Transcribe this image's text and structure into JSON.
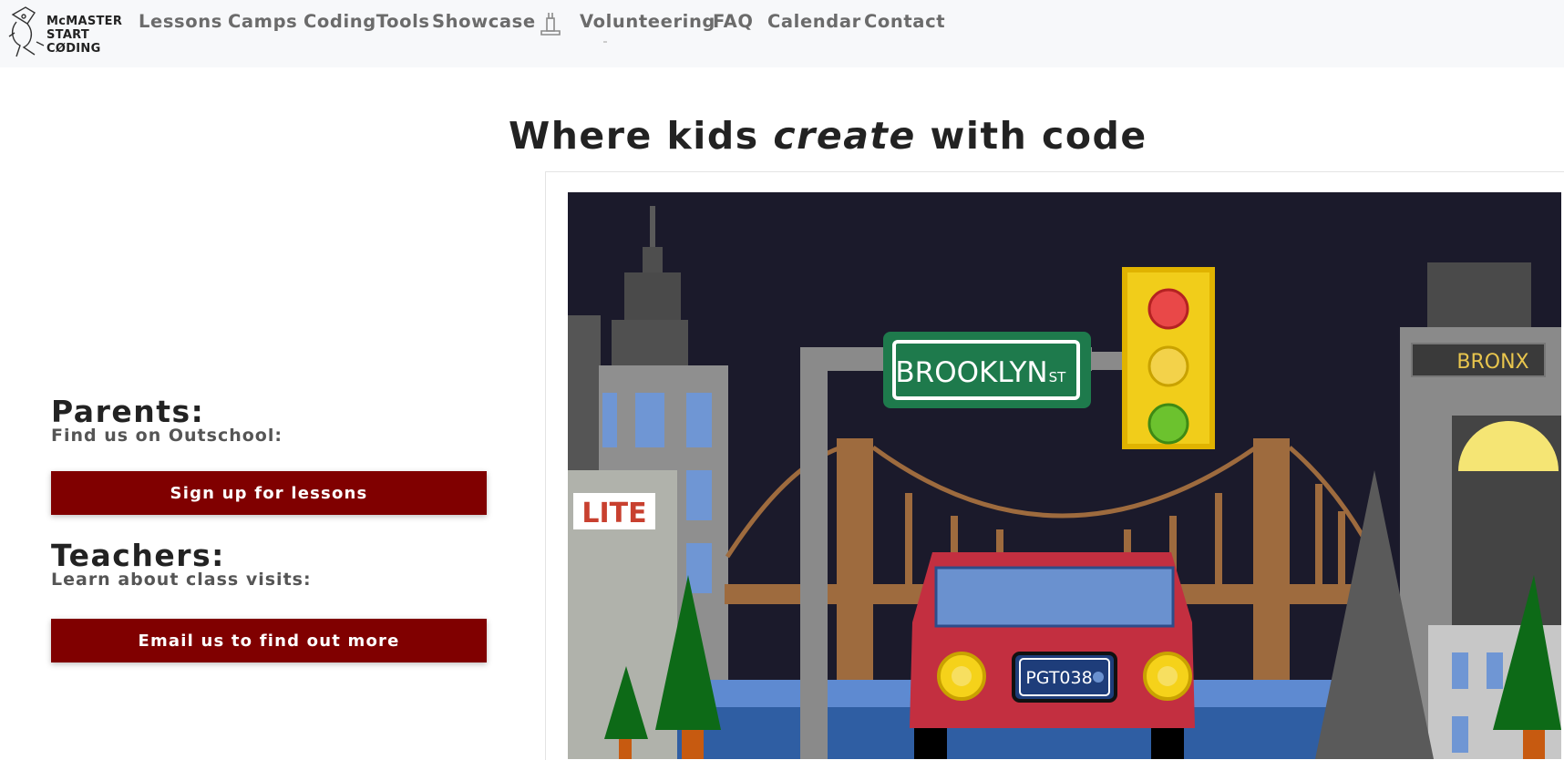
{
  "logo": {
    "line1": "McMASTER",
    "line2": "START",
    "line3": "CØDING"
  },
  "nav": {
    "items": [
      {
        "label": "Lessons"
      },
      {
        "label": "Camps"
      },
      {
        "label": "CodingTools"
      },
      {
        "label": "Showcase"
      },
      {
        "label": "Volunteering"
      },
      {
        "label": "FAQ"
      },
      {
        "label": "Calendar"
      },
      {
        "label": "Contact"
      }
    ],
    "icon": "tower-icon"
  },
  "hero": {
    "prefix": "Where kids ",
    "emphasis": "create",
    "suffix": " with code"
  },
  "parents": {
    "heading": "Parents:",
    "subtext": "Find us on Outschool:",
    "button": "Sign up for lessons"
  },
  "teachers": {
    "heading": "Teachers:",
    "subtext": "Learn about class visits:",
    "button": "Email us to find out more"
  },
  "illustration": {
    "street_sign": "BROOKLYN",
    "street_sign_suffix": "ST",
    "building_sign": "BRONX",
    "store_sign": "LITE",
    "license_plate": "PGT038"
  },
  "colors": {
    "accent": "#800000",
    "navbar_bg": "#f7f8fa",
    "nav_text": "#6b6b6b",
    "night_sky": "#1b1a2b"
  }
}
